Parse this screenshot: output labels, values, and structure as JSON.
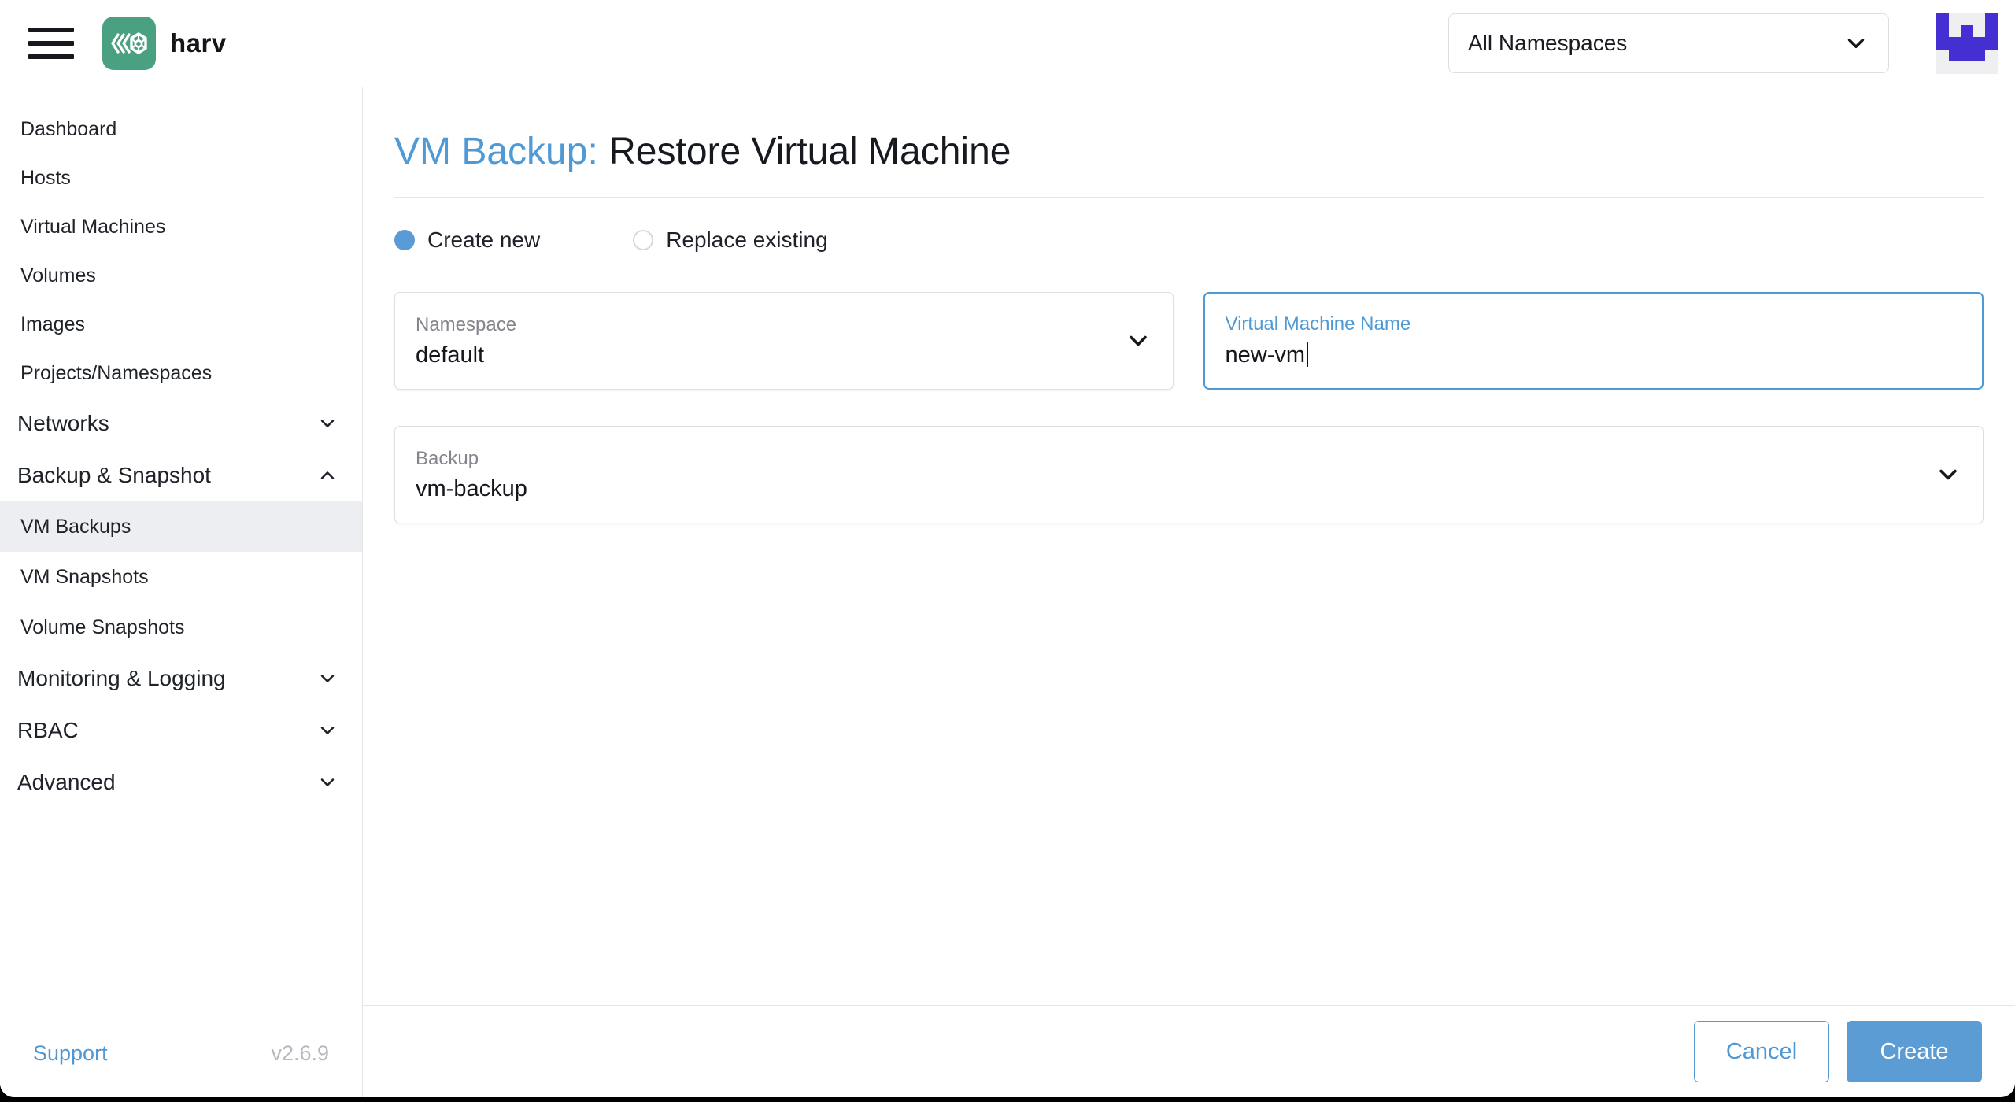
{
  "header": {
    "brand": "harv",
    "namespace_filter": "All Namespaces"
  },
  "sidebar": {
    "items": [
      {
        "label": "Dashboard",
        "type": "link"
      },
      {
        "label": "Hosts",
        "type": "link"
      },
      {
        "label": "Virtual Machines",
        "type": "link"
      },
      {
        "label": "Volumes",
        "type": "link"
      },
      {
        "label": "Images",
        "type": "link"
      },
      {
        "label": "Projects/Namespaces",
        "type": "link"
      },
      {
        "label": "Networks",
        "type": "group",
        "state": "collapsed"
      },
      {
        "label": "Backup & Snapshot",
        "type": "group",
        "state": "expanded"
      },
      {
        "label": "VM Backups",
        "type": "sub-link",
        "selected": true
      },
      {
        "label": "VM Snapshots",
        "type": "sub-link",
        "selected": false
      },
      {
        "label": "Volume Snapshots",
        "type": "sub-link",
        "selected": false
      },
      {
        "label": "Monitoring & Logging",
        "type": "group",
        "state": "collapsed"
      },
      {
        "label": "RBAC",
        "type": "group",
        "state": "collapsed"
      },
      {
        "label": "Advanced",
        "type": "group",
        "state": "collapsed"
      }
    ],
    "footer": {
      "support_label": "Support",
      "version": "v2.6.9"
    }
  },
  "main": {
    "title_prefix": "VM Backup:",
    "title": "Restore Virtual Machine",
    "radios": [
      {
        "label": "Create new",
        "selected": true
      },
      {
        "label": "Replace existing",
        "selected": false
      }
    ],
    "fields": {
      "namespace": {
        "label": "Namespace",
        "value": "default",
        "type": "select"
      },
      "vm_name": {
        "label": "Virtual Machine Name",
        "value": "new-vm",
        "type": "text",
        "focused": true
      },
      "backup": {
        "label": "Backup",
        "value": "vm-backup",
        "type": "select"
      }
    },
    "actions": {
      "cancel_label": "Cancel",
      "create_label": "Create"
    }
  },
  "colors": {
    "accent_blue": "#4f9ad5",
    "primary_button": "#5b9cd5",
    "logo_green": "#4aa181",
    "avatar_purple": "#4430d2",
    "selected_row_bg": "#eceef2",
    "text_dark": "#1f2329",
    "label_gray": "#84858c",
    "border_gray": "#dcdee3",
    "version_gray": "#b7b9c0"
  },
  "icons": [
    "hamburger-menu-icon",
    "harvester-logo-icon",
    "chevron-down-icon",
    "chevron-up-icon",
    "avatar-identicon"
  ]
}
